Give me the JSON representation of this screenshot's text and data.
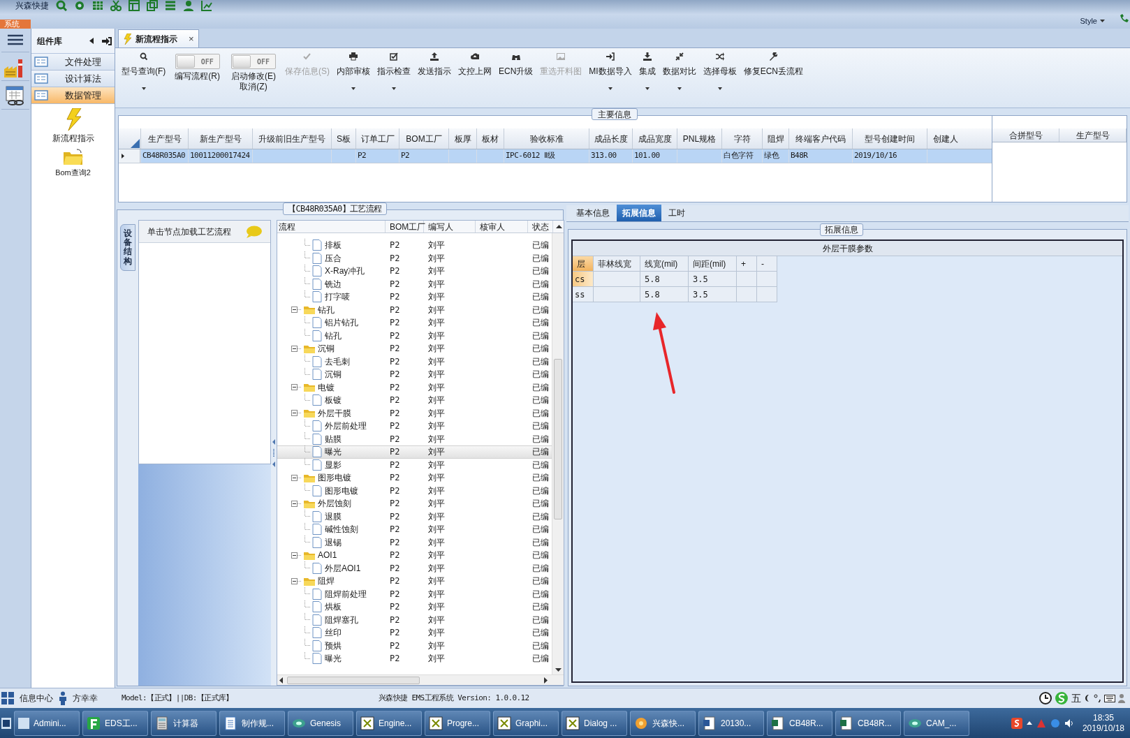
{
  "app": {
    "brand": "兴森快捷",
    "system_tab": "系统",
    "style_menu": "Style"
  },
  "component_panel": {
    "title": "组件库",
    "categories": [
      {
        "label": "文件处理",
        "selected": false
      },
      {
        "label": "设计算法",
        "selected": false
      },
      {
        "label": "数据管理",
        "selected": true
      }
    ],
    "items": [
      {
        "label": "新流程指示"
      },
      {
        "label": "Bom查询2"
      }
    ]
  },
  "document_tab": {
    "label": "新流程指示",
    "close": "×"
  },
  "toolbar": [
    {
      "label": "型号查询(F)",
      "kind": "button",
      "dropdown": true,
      "disabled": false
    },
    {
      "label": "编写流程(R)",
      "kind": "toggle",
      "switch_text": "OFF",
      "on": false
    },
    {
      "label": "启动修改(E)\n取消(Z)",
      "kind": "toggle",
      "switch_text": "OFF",
      "on": false
    },
    {
      "label": "保存信息(S)",
      "kind": "button",
      "dropdown": false,
      "disabled": true
    },
    {
      "label": "内部审核",
      "kind": "button",
      "dropdown": true,
      "disabled": false
    },
    {
      "label": "指示检查",
      "kind": "button",
      "dropdown": true,
      "disabled": false
    },
    {
      "label": "发送指示",
      "kind": "button",
      "dropdown": false,
      "disabled": false
    },
    {
      "label": "文控上网",
      "kind": "button",
      "dropdown": false,
      "disabled": false
    },
    {
      "label": "ECN升级",
      "kind": "button",
      "dropdown": false,
      "disabled": false
    },
    {
      "label": "重选开料图",
      "kind": "button",
      "dropdown": false,
      "disabled": true
    },
    {
      "label": "MI数据导入",
      "kind": "button",
      "dropdown": true,
      "disabled": false
    },
    {
      "label": "集成",
      "kind": "button",
      "dropdown": true,
      "disabled": false
    },
    {
      "label": "数据对比",
      "kind": "button",
      "dropdown": true,
      "disabled": false
    },
    {
      "label": "选择母板",
      "kind": "button",
      "dropdown": true,
      "disabled": false
    },
    {
      "label": "修复ECN丢流程",
      "kind": "button",
      "dropdown": false,
      "disabled": false
    }
  ],
  "main_info": {
    "title": "主要信息",
    "columns": [
      "生产型号",
      "新生产型号",
      "升级前旧生产型号",
      "S板",
      "订单工厂",
      "BOM工厂",
      "板厚",
      "板材",
      "验收标准",
      "成品长度",
      "成品宽度",
      "PNL规格",
      "字符",
      "阻焊",
      "终端客户代码",
      "型号创建时间",
      "创建人"
    ],
    "rows": [
      {
        "selected": true,
        "cells": [
          "CB48R035A0",
          "10011200017424",
          "",
          "",
          "P2",
          "P2",
          "",
          "",
          "IPC-6012 Ⅱ级",
          "313.00",
          "101.00",
          "",
          "白色字符",
          "绿色",
          "B48R",
          "2019/10/16",
          ""
        ]
      }
    ],
    "side_columns": [
      "合拼型号",
      "生产型号"
    ]
  },
  "process": {
    "title": "【CB48R035A0】工艺流程",
    "side_tab": "设备结构",
    "hint": "单击节点加载工艺流程",
    "columns": [
      "流程",
      "BOM工厂",
      "编写人",
      "核审人",
      "状态"
    ],
    "rows": [
      {
        "children": [
          {
            "label": "排板",
            "bom": "P2",
            "writer": "刘平",
            "status": "已编",
            "selected": false
          },
          {
            "label": "压合",
            "bom": "P2",
            "writer": "刘平",
            "status": "已编",
            "selected": false
          },
          {
            "label": "X-Ray冲孔",
            "bom": "P2",
            "writer": "刘平",
            "status": "已编",
            "selected": false
          },
          {
            "label": "铣边",
            "bom": "P2",
            "writer": "刘平",
            "status": "已编",
            "selected": false
          },
          {
            "label": "打字唛",
            "bom": "P2",
            "writer": "刘平",
            "status": "已编",
            "selected": false
          }
        ]
      },
      {
        "label": "钻孔",
        "bom": "P2",
        "writer": "刘平",
        "status": "已编",
        "selected": false,
        "expanded": true,
        "children": [
          {
            "label": "铝片钻孔",
            "bom": "P2",
            "writer": "刘平",
            "status": "已编",
            "selected": false
          },
          {
            "label": "钻孔",
            "bom": "P2",
            "writer": "刘平",
            "status": "已编",
            "selected": false
          }
        ]
      },
      {
        "label": "沉铜",
        "bom": "P2",
        "writer": "刘平",
        "status": "已编",
        "selected": false,
        "expanded": true,
        "children": [
          {
            "label": "去毛刺",
            "bom": "P2",
            "writer": "刘平",
            "status": "已编",
            "selected": false
          },
          {
            "label": "沉铜",
            "bom": "P2",
            "writer": "刘平",
            "status": "已编",
            "selected": false
          }
        ]
      },
      {
        "label": "电镀",
        "bom": "P2",
        "writer": "刘平",
        "status": "已编",
        "selected": false,
        "expanded": true,
        "children": [
          {
            "label": "板镀",
            "bom": "P2",
            "writer": "刘平",
            "status": "已编",
            "selected": false
          }
        ]
      },
      {
        "label": "外层干膜",
        "bom": "P2",
        "writer": "刘平",
        "status": "已编",
        "selected": false,
        "expanded": true,
        "children": [
          {
            "label": "外层前处理",
            "bom": "P2",
            "writer": "刘平",
            "status": "已编",
            "selected": false
          },
          {
            "label": "贴膜",
            "bom": "P2",
            "writer": "刘平",
            "status": "已编",
            "selected": false
          },
          {
            "label": "曝光",
            "bom": "P2",
            "writer": "刘平",
            "status": "已编",
            "selected": true
          },
          {
            "label": "显影",
            "bom": "P2",
            "writer": "刘平",
            "status": "已编",
            "selected": false
          }
        ]
      },
      {
        "label": "图形电镀",
        "bom": "P2",
        "writer": "刘平",
        "status": "已编",
        "selected": false,
        "expanded": true,
        "children": [
          {
            "label": "图形电镀",
            "bom": "P2",
            "writer": "刘平",
            "status": "已编",
            "selected": false
          }
        ]
      },
      {
        "label": "外层蚀刻",
        "bom": "P2",
        "writer": "刘平",
        "status": "已编",
        "selected": false,
        "expanded": true,
        "children": [
          {
            "label": "退膜",
            "bom": "P2",
            "writer": "刘平",
            "status": "已编",
            "selected": false
          },
          {
            "label": "碱性蚀刻",
            "bom": "P2",
            "writer": "刘平",
            "status": "已编",
            "selected": false
          },
          {
            "label": "退锡",
            "bom": "P2",
            "writer": "刘平",
            "status": "已编",
            "selected": false
          }
        ]
      },
      {
        "label": "AOI1",
        "bom": "P2",
        "writer": "刘平",
        "status": "已编",
        "selected": false,
        "expanded": true,
        "children": [
          {
            "label": "外层AOI1",
            "bom": "P2",
            "writer": "刘平",
            "status": "已编",
            "selected": false
          }
        ]
      },
      {
        "label": "阻焊",
        "bom": "P2",
        "writer": "刘平",
        "status": "已编",
        "selected": false,
        "expanded": true,
        "children": [
          {
            "label": "阻焊前处理",
            "bom": "P2",
            "writer": "刘平",
            "status": "已编",
            "selected": false
          },
          {
            "label": "烘板",
            "bom": "P2",
            "writer": "刘平",
            "status": "已编",
            "selected": false
          },
          {
            "label": "阻焊塞孔",
            "bom": "P2",
            "writer": "刘平",
            "status": "已编",
            "selected": false
          },
          {
            "label": "丝印",
            "bom": "P2",
            "writer": "刘平",
            "status": "已编",
            "selected": false
          },
          {
            "label": "预烘",
            "bom": "P2",
            "writer": "刘平",
            "status": "已编",
            "selected": false
          },
          {
            "label": "曝光",
            "bom": "P2",
            "writer": "刘平",
            "status": "已编",
            "selected": false
          }
        ]
      }
    ]
  },
  "details": {
    "tabs": [
      {
        "label": "基本信息",
        "selected": false
      },
      {
        "label": "拓展信息",
        "selected": true
      },
      {
        "label": "工时",
        "selected": false
      }
    ],
    "group_title": "拓展信息",
    "table": {
      "title": "外层干膜参数",
      "columns": [
        "层",
        "菲林线宽",
        "线宽(mil)",
        "间距(mil)",
        "+",
        "-"
      ],
      "rows": [
        {
          "selected": true,
          "cells": [
            "cs",
            "",
            "5.8",
            "3.5",
            "",
            ""
          ]
        },
        {
          "selected": false,
          "cells": [
            "ss",
            "",
            "5.8",
            "3.5",
            "",
            ""
          ]
        }
      ]
    }
  },
  "status_bar": {
    "info_center": "信息中心",
    "user": "方幸幸",
    "model": "Model:【正式】||DB:【正式库】",
    "version": "兴森快捷 EMS工程系统 Version: 1.0.0.12",
    "ime": "五"
  },
  "taskbar": {
    "items": [
      {
        "label": "Admini..."
      },
      {
        "label": "EDS工..."
      },
      {
        "label": "计算器"
      },
      {
        "label": "制作规..."
      },
      {
        "label": "Genesis"
      },
      {
        "label": "Engine..."
      },
      {
        "label": "Progre..."
      },
      {
        "label": "Graphi..."
      },
      {
        "label": "Dialog ..."
      },
      {
        "label": "兴森快..."
      },
      {
        "label": "20130..."
      },
      {
        "label": "CB48R..."
      },
      {
        "label": "CB48R..."
      },
      {
        "label": "CAM_..."
      }
    ],
    "time": "18:35",
    "date": "2019/10/18"
  }
}
